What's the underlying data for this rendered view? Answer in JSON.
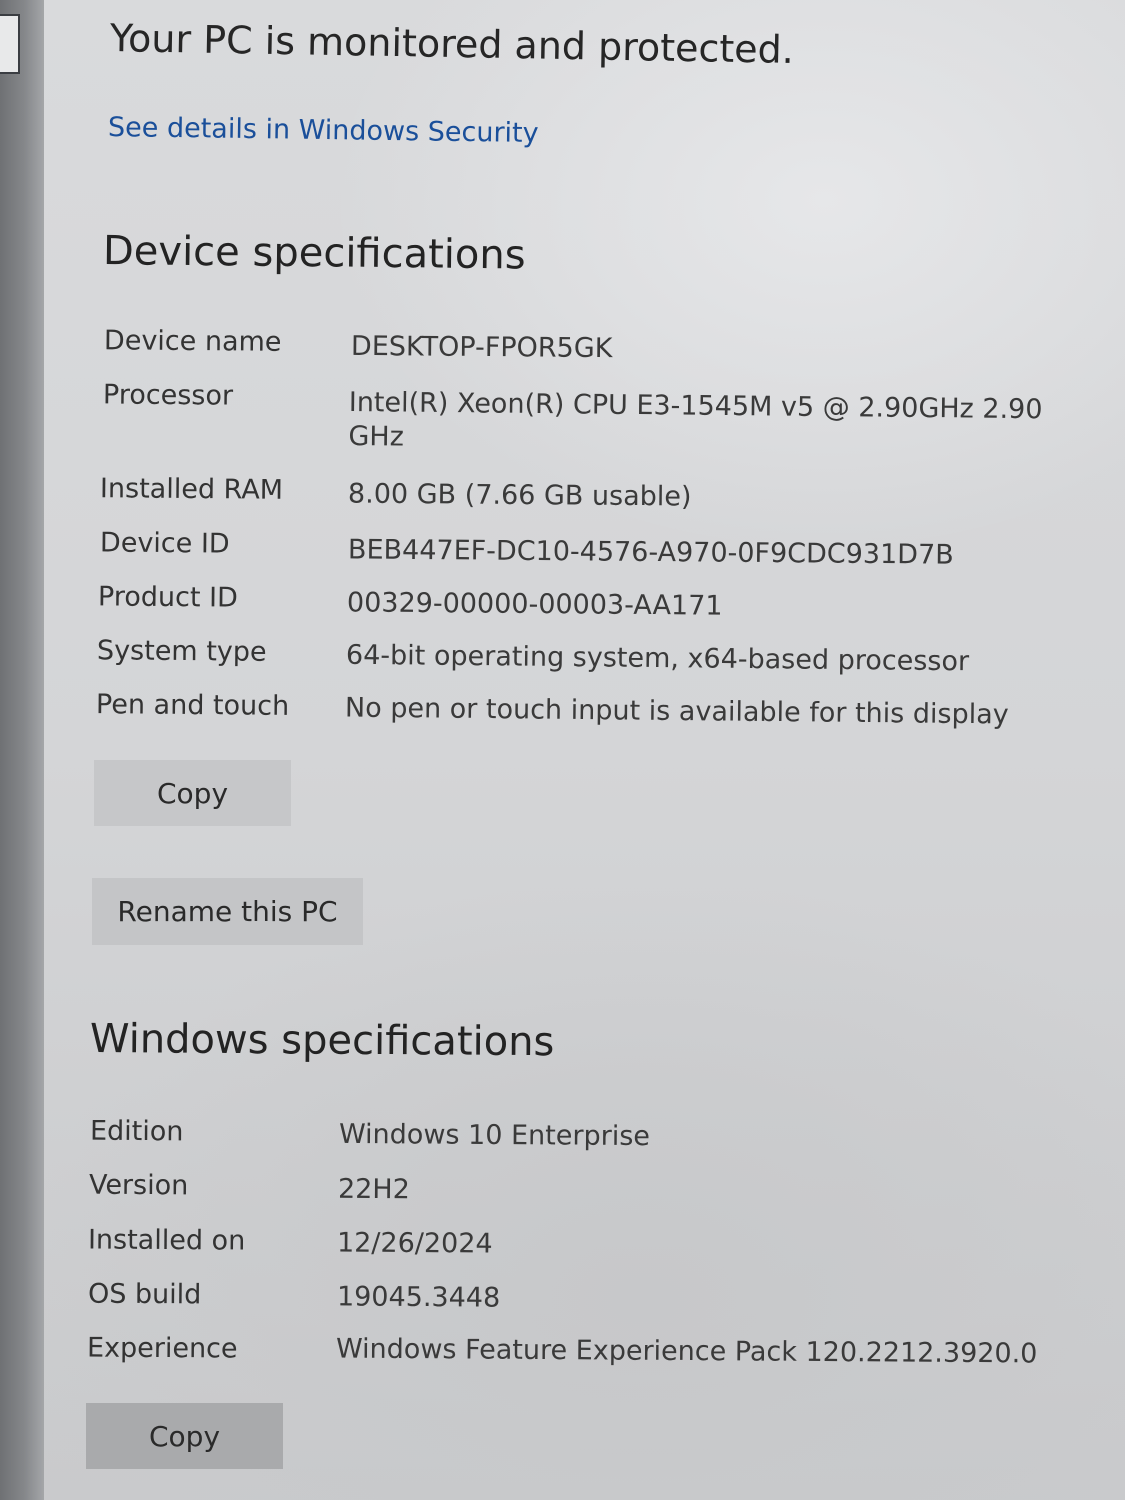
{
  "protection": {
    "title": "Your PC is monitored and protected.",
    "link": "See details in Windows Security"
  },
  "device_specs": {
    "heading": "Device specifications",
    "rows": [
      {
        "label": "Device name",
        "value": "DESKTOP-FPOR5GK"
      },
      {
        "label": "Processor",
        "value": "Intel(R) Xeon(R) CPU E3-1545M v5 @ 2.90GHz   2.90 GHz"
      },
      {
        "label": "Installed RAM",
        "value": "8.00 GB (7.66 GB usable)"
      },
      {
        "label": "Device ID",
        "value": "BEB447EF-DC10-4576-A970-0F9CDC931D7B"
      },
      {
        "label": "Product ID",
        "value": "00329-00000-00003-AA171"
      },
      {
        "label": "System type",
        "value": "64-bit operating system, x64-based processor"
      },
      {
        "label": "Pen and touch",
        "value": "No pen or touch input is available for this display"
      }
    ],
    "copy_label": "Copy",
    "rename_label": "Rename this PC"
  },
  "windows_specs": {
    "heading": "Windows specifications",
    "rows": [
      {
        "label": "Edition",
        "value": "Windows 10 Enterprise"
      },
      {
        "label": "Version",
        "value": "22H2"
      },
      {
        "label": "Installed on",
        "value": "12/26/2024"
      },
      {
        "label": "OS build",
        "value": "19045.3448"
      },
      {
        "label": "Experience",
        "value": "Windows Feature Experience Pack 120.2212.3920.0"
      }
    ],
    "copy_label": "Copy"
  }
}
